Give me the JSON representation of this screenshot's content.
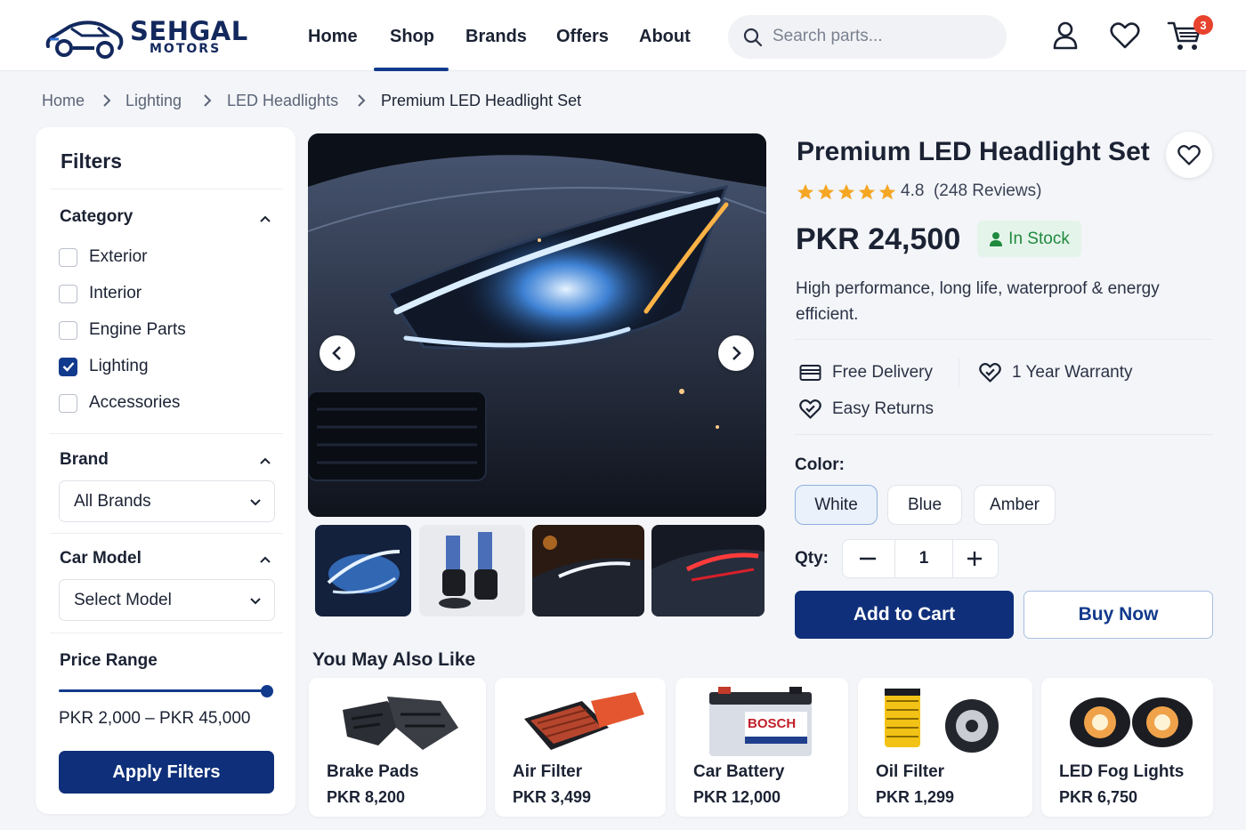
{
  "brand": {
    "name": "SEHGAL",
    "sub": "MOTORS"
  },
  "nav": {
    "home": "Home",
    "shop": "Shop",
    "brands": "Brands",
    "offers": "Offers",
    "about": "About"
  },
  "search": {
    "placeholder": "Search parts..."
  },
  "cart": {
    "count": "3"
  },
  "breadcrumb": [
    "Home",
    "Lighting",
    "LED Headlights",
    "Premium LED Headlight Set"
  ],
  "filters": {
    "title": "Filters",
    "category": {
      "title": "Category",
      "options": [
        {
          "label": "Exterior",
          "checked": false
        },
        {
          "label": "Interior",
          "checked": false
        },
        {
          "label": "Engine Parts",
          "checked": false
        },
        {
          "label": "Lighting",
          "checked": true
        },
        {
          "label": "Accessories",
          "checked": false
        }
      ]
    },
    "brand": {
      "title": "Brand",
      "value": "All Brands"
    },
    "car_model": {
      "title": "Car Model",
      "value": "Select Model"
    },
    "price": {
      "title": "Price Range",
      "text": "PKR 2,000 – PKR 45,000"
    },
    "apply": "Apply Filters"
  },
  "product": {
    "title": "Premium LED Headlight Set",
    "rating": "4.8",
    "reviews": "(248 Reviews)",
    "stars": 5,
    "price": "PKR 24,500",
    "stock": "In Stock",
    "description": "High performance, long life, waterproof & energy efficient.",
    "features": {
      "delivery": "Free Delivery",
      "warranty": "1 Year Warranty",
      "returns": "Easy Returns"
    },
    "color_label": "Color:",
    "colors": [
      "White",
      "Blue",
      "Amber"
    ],
    "selected_color": "White",
    "qty_label": "Qty:",
    "qty": "1",
    "add_to_cart": "Add to Cart",
    "buy_now": "Buy Now"
  },
  "related": {
    "title": "You May Also Like",
    "items": [
      {
        "name": "Brake Pads",
        "price": "PKR 8,200"
      },
      {
        "name": "Air Filter",
        "price": "PKR 3,499"
      },
      {
        "name": "Car Battery",
        "price": "PKR 12,000"
      },
      {
        "name": "Oil Filter",
        "price": "PKR 1,299"
      },
      {
        "name": "LED Fog Lights",
        "price": "PKR 6,750"
      }
    ],
    "battery_label": "BOSCH"
  },
  "colors": {
    "primary": "#0f2f7a",
    "accent": "#123a8c",
    "star": "#f5a623",
    "stock": "#1f8a3e",
    "badge": "#e8432e"
  }
}
